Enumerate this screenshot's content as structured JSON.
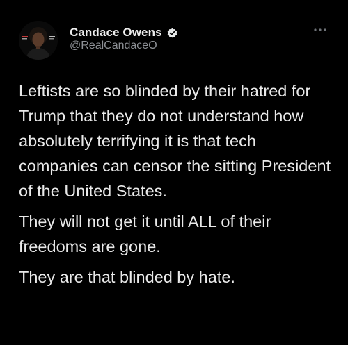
{
  "tweet": {
    "author": {
      "display_name": "Candace Owens",
      "handle": "@RealCandaceO",
      "verified": true,
      "avatar_icon": "profile-photo"
    },
    "more_icon": "ellipsis-icon",
    "paragraphs": [
      "Leftists are so blinded by their hatred for Trump that they do not understand how absolutely terrifying it is that tech companies can censor the sitting President of the United States.",
      "They will not get it until ALL of their freedoms are gone.",
      "They are that blinded by hate."
    ]
  },
  "colors": {
    "background": "#000000",
    "text": "#e9e9e9",
    "secondary_text": "#8d9095",
    "verified_badge": "#e7e9ea"
  }
}
